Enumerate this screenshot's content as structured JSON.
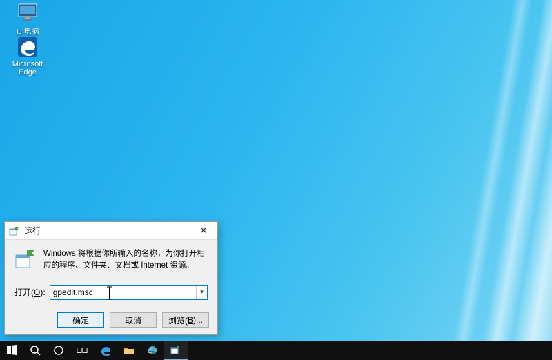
{
  "desktop": {
    "icons": [
      {
        "id": "this-pc",
        "label": "此电脑"
      },
      {
        "id": "edge",
        "label": "Microsoft\nEdge"
      }
    ]
  },
  "run_dialog": {
    "title": "运行",
    "description": "Windows 将根据你所输入的名称，为你打开相应的程序、文件夹、文档或 Internet 资源。",
    "open_label_prefix": "打开(",
    "open_label_hotkey": "O",
    "open_label_suffix": "):",
    "input_value": "gpedit.msc",
    "buttons": {
      "ok": "确定",
      "cancel": "取消",
      "browse_prefix": "浏览(",
      "browse_hotkey": "B",
      "browse_suffix": ")..."
    }
  },
  "taskbar": {
    "items": [
      {
        "id": "start",
        "name": "start-button"
      },
      {
        "id": "search",
        "name": "search-button"
      },
      {
        "id": "cortana",
        "name": "cortana-button"
      },
      {
        "id": "taskview",
        "name": "task-view-button"
      },
      {
        "id": "edge",
        "name": "taskbar-edge"
      },
      {
        "id": "explorer",
        "name": "taskbar-file-explorer"
      },
      {
        "id": "ie",
        "name": "taskbar-ie"
      },
      {
        "id": "run",
        "name": "taskbar-run-active"
      }
    ]
  },
  "colors": {
    "accent": "#0078d7",
    "taskbar": "#101010"
  }
}
